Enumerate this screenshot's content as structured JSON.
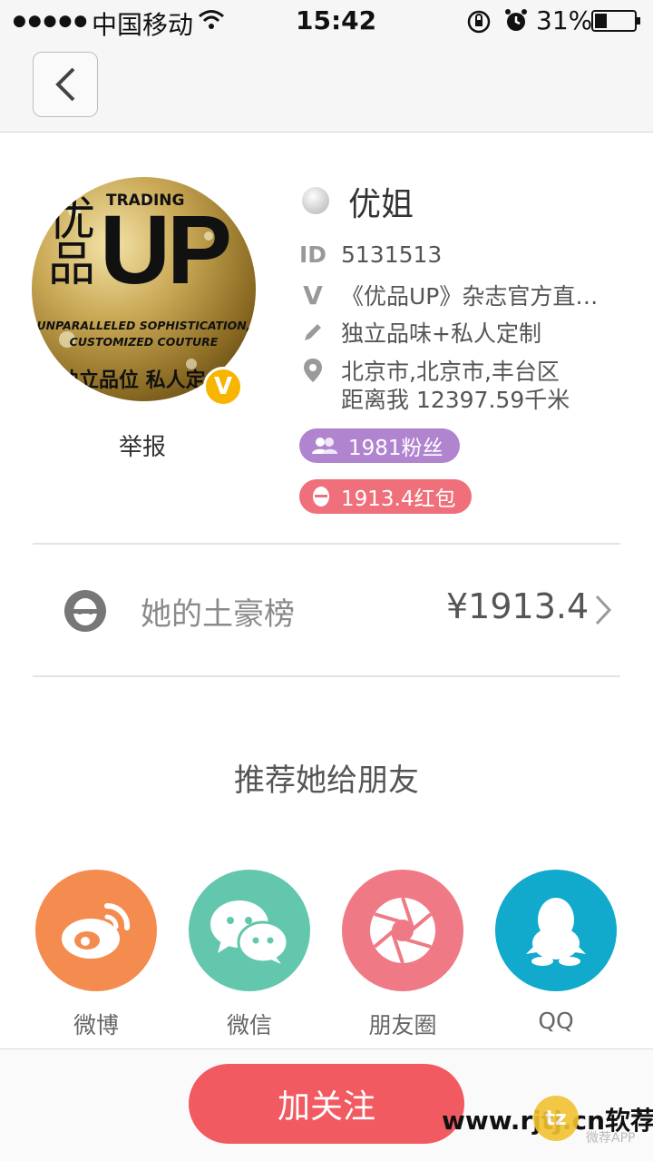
{
  "status_bar": {
    "signal_dots": "●●●●●",
    "carrier": "中国移动",
    "time": "15:42",
    "battery_percent": "31%",
    "battery_level": 0.31
  },
  "nav": {
    "back_icon": "chevron-left-icon"
  },
  "profile": {
    "avatar_text": {
      "cn_big": "优品",
      "trading": "TRADING",
      "up": "UP",
      "line1": "UNPARALLELED SOPHISTICATION,",
      "line2": "CUSTOMIZED COUTURE",
      "bottom": "独立品位  私人定"
    },
    "verified_badge": "V",
    "report_label": "举报",
    "name": "优姐",
    "id_label": "ID",
    "id_value": "5131513",
    "verify_label": "V",
    "verify_text": "《优品UP》杂志官方直…",
    "signature": "独立品味+私人定制",
    "location_line1": "北京市,北京市,丰台区",
    "location_line2": "距离我 12397.59千米",
    "fans_pill": "1981粉丝",
    "redpacket_pill": "1913.4红包"
  },
  "rich_list": {
    "label": "她的土豪榜",
    "amount": "¥1913.4"
  },
  "share": {
    "title": "推荐她给朋友",
    "items": [
      {
        "label": "微博",
        "icon": "weibo-icon",
        "color": "#f58c4f"
      },
      {
        "label": "微信",
        "icon": "wechat-icon",
        "color": "#62c7ad"
      },
      {
        "label": "朋友圈",
        "icon": "moments-icon",
        "color": "#ef7a85"
      },
      {
        "label": "QQ",
        "icon": "qq-icon",
        "color": "#11aacc"
      }
    ]
  },
  "follow_button": "加关注",
  "watermark": {
    "url": "www.rjtj.cn软荐网",
    "logo": "tz",
    "sub": "微荐APP"
  },
  "colors": {
    "fans_pill": "#b084cf",
    "redpacket_pill": "#ef6f7a",
    "follow": "#f25a62",
    "badge": "#f7b500"
  }
}
